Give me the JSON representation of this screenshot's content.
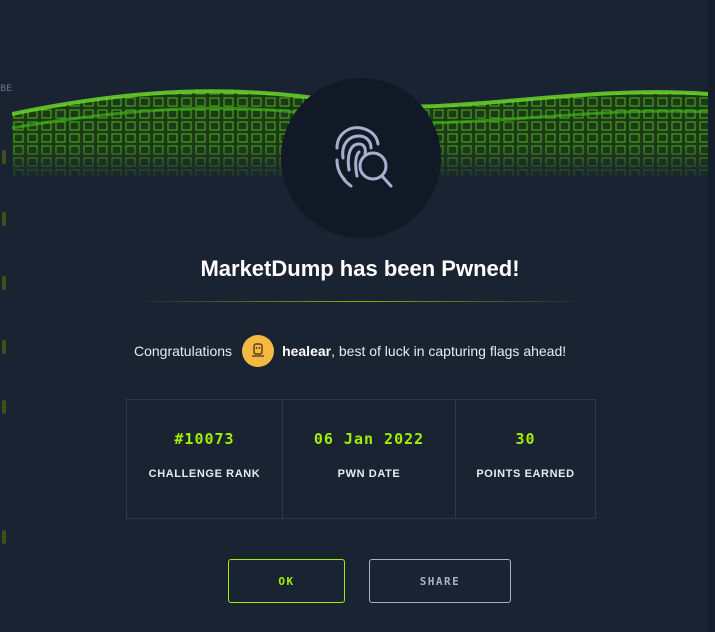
{
  "modal": {
    "title": "MarketDump has been Pwned!",
    "congrats_prefix": "Congratulations",
    "username": "healear",
    "congrats_suffix": ", best of luck in capturing flags ahead!",
    "stats": [
      {
        "value": "#10073",
        "label": "CHALLENGE RANK"
      },
      {
        "value": "06 Jan 2022",
        "label": "PWN DATE"
      },
      {
        "value": "30",
        "label": "POINTS EARNED"
      }
    ],
    "buttons": {
      "ok": "OK",
      "share": "SHARE"
    },
    "icon": "fingerprint-search-icon"
  },
  "background": {
    "left_text": "BE"
  },
  "colors": {
    "accent": "#9fef00",
    "modal_bg": "#1a2332",
    "page_bg": "#141d2b",
    "avatar_bg": "#f5b942"
  }
}
